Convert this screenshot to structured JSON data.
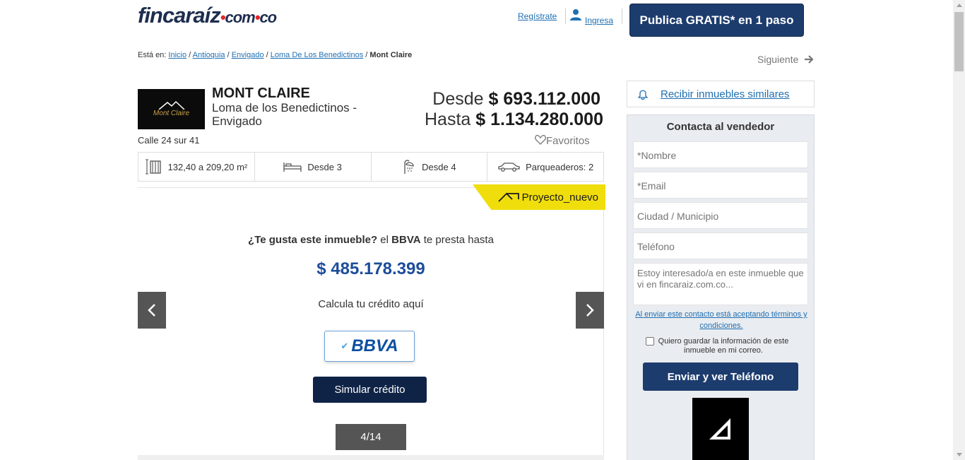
{
  "header": {
    "logo_text": "fincaraíz",
    "logo_domain": "com",
    "logo_tld": "co",
    "register_label": "Regístrate",
    "login_label": "Ingresa",
    "publish_label": "Publica GRATIS* en 1 paso"
  },
  "breadcrumb": {
    "prefix": "Está en:",
    "items": [
      "Inicio",
      "Antioquia",
      "Envigado",
      "Loma De Los Benedictinos"
    ],
    "current": "Mont Claire",
    "next_label": "Siguiente"
  },
  "property": {
    "logo_text": "Mont Claire",
    "title": "MONT CLAIRE",
    "subtitle": "Loma de los Benedictinos - Envigado",
    "price_from_label": "Desde",
    "price_from": "$ 693.112.000",
    "price_to_label": "Hasta",
    "price_to": "$ 1.134.280.000",
    "address": "Calle 24 sur 41",
    "favorites_label": "Favoritos",
    "features": {
      "area": "132,40 a 209,20 m²",
      "bedrooms": "Desde  3",
      "bathrooms": "Desde  4",
      "parking": "Parqueaderos: 2"
    },
    "tag": "Proyecto_nuevo"
  },
  "gallery": {
    "question_bold": "¿Te gusta este inmueble?",
    "question_mid": " el ",
    "question_bank": "BBVA",
    "question_end": " te presta hasta",
    "amount": "$ 485.178.399",
    "calc_label": "Calcula tu crédito aquí",
    "bank_logo": "BBVA",
    "simulate_label": "Simular crédito",
    "counter": "4/14"
  },
  "sidebar": {
    "alert_label": "Recibir inmuebles similares",
    "contact_title": "Contacta al vendedor",
    "name_placeholder": "*Nombre",
    "email_placeholder": "*Email",
    "city_placeholder": "Ciudad / Municipio",
    "phone_placeholder": "Teléfono",
    "message_placeholder": "Estoy interesado/a en este inmueble que vi en fincaraiz.com.co...",
    "terms_text": "Al enviar este contacto está aceptando términos y condiciones.",
    "save_info_label": "Quiero guardar la información de este inmueble en mi correo.",
    "send_label": "Enviar y ver Teléfono"
  },
  "colors": {
    "brand_navy": "#1d3c6e",
    "link_blue": "#1f6fb2",
    "tag_yellow": "#f0dd0c",
    "amount_blue": "#1d4d9b"
  }
}
